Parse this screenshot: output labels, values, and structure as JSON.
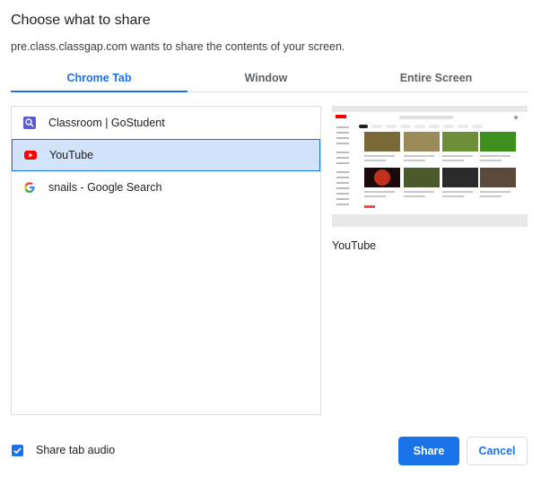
{
  "dialog": {
    "title": "Choose what to share",
    "subtitle": "pre.class.classgap.com wants to share the contents of your screen."
  },
  "tabs": [
    {
      "label": "Chrome Tab",
      "active": true
    },
    {
      "label": "Window",
      "active": false
    },
    {
      "label": "Entire Screen",
      "active": false
    }
  ],
  "list": {
    "items": [
      {
        "label": "Classroom | GoStudent",
        "icon": "gostudent-icon",
        "selected": false
      },
      {
        "label": "YouTube",
        "icon": "youtube-icon",
        "selected": true
      },
      {
        "label": "snails - Google Search",
        "icon": "google-icon",
        "selected": false
      }
    ]
  },
  "preview": {
    "label": "YouTube"
  },
  "footer": {
    "audio_label": "Share tab audio",
    "audio_checked": true,
    "share_label": "Share",
    "cancel_label": "Cancel"
  },
  "colors": {
    "accent": "#1a73e8",
    "selected_bg": "#d2e3fc",
    "youtube_red": "#ff0000",
    "gostudent_purple": "#5b5bd6"
  }
}
